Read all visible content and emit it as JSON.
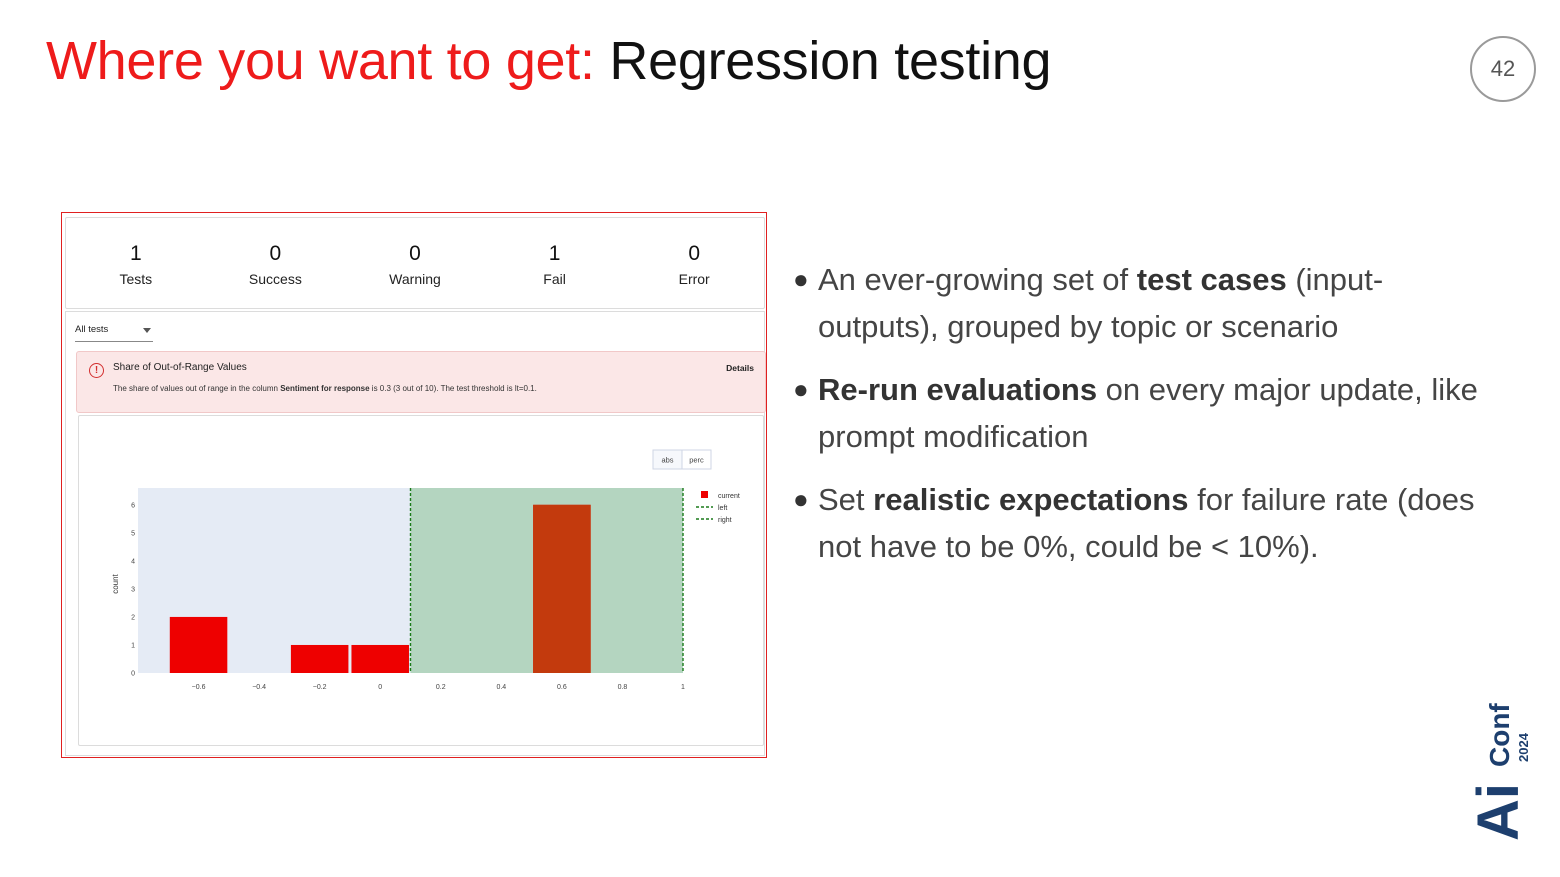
{
  "title": {
    "accent": "Where you want to get:",
    "rest": "Regression testing"
  },
  "page_number": "42",
  "summary": [
    {
      "value": "1",
      "label": "Tests"
    },
    {
      "value": "0",
      "label": "Success"
    },
    {
      "value": "0",
      "label": "Warning"
    },
    {
      "value": "1",
      "label": "Fail"
    },
    {
      "value": "0",
      "label": "Error"
    }
  ],
  "filter": {
    "selected": "All tests"
  },
  "alert": {
    "title": "Share of Out-of-Range Values",
    "details": "Details",
    "desc_pre": "The share of values out of range in the column ",
    "desc_bold": "Sentiment for response",
    "desc_post": " is 0.3 (3 out of 10). The test threshold is lt=0.1."
  },
  "toggle": {
    "abs": "abs",
    "perc": "perc"
  },
  "chart_data": {
    "type": "bar",
    "x": [
      -0.6,
      -0.2,
      0,
      0.6
    ],
    "values": [
      2,
      1,
      1,
      6
    ],
    "bar_width": 0.2,
    "ylabel": "count",
    "xlim": [
      -0.8,
      1
    ],
    "ylim": [
      0,
      6.6
    ],
    "x_ticks": [
      "−0.6",
      "−0.4",
      "−0.2",
      "0",
      "0.2",
      "0.4",
      "0.6",
      "0.8",
      "1"
    ],
    "y_ticks": [
      "0",
      "1",
      "2",
      "3",
      "4",
      "5",
      "6"
    ],
    "range_left": 0.1,
    "range_right": 1,
    "legend": [
      "current",
      "left",
      "right"
    ],
    "legend_position": "top-right",
    "colors": {
      "current": "#ee0000",
      "in_range": "#b4d5c0",
      "out_range": "#e5ebf5",
      "reference_line": "#1a7a1a",
      "overlap": "#c33a0d"
    }
  },
  "bullets": [
    {
      "pre": "An ever-growing set of ",
      "bold": "test cases",
      "post": " (input-outputs), grouped by topic or scenario"
    },
    {
      "pre": "",
      "bold": "Re-run evaluations",
      "post": " on every major update, like prompt modification"
    },
    {
      "pre": "Set ",
      "bold": "realistic expectations",
      "post": " for failure rate (does not have to be 0%, could be < 10%)."
    }
  ],
  "logo": {
    "text": "Ai Conf 2024"
  }
}
